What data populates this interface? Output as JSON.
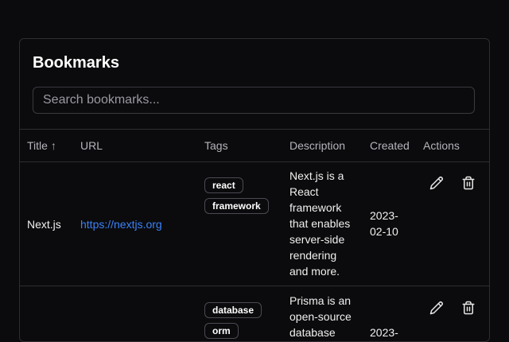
{
  "title": "Bookmarks",
  "search": {
    "placeholder": "Search bookmarks...",
    "value": ""
  },
  "columns": {
    "title": "Title ↑",
    "url": "URL",
    "tags": "Tags",
    "description": "Description",
    "created": "Created",
    "actions": "Actions"
  },
  "rows": [
    {
      "title": "Next.js",
      "url": "https://nextjs.org",
      "tags": [
        "react",
        "framework"
      ],
      "description": [
        "Next.js is a",
        "React",
        "framework",
        "that enables",
        "server-side",
        "rendering",
        "and more."
      ],
      "created": [
        "2023-",
        "02-10"
      ]
    },
    {
      "title": "",
      "url": "",
      "tags": [
        "database",
        "orm"
      ],
      "description": [
        "Prisma is an",
        "open-source",
        "database"
      ],
      "created": [
        "2023-"
      ]
    }
  ],
  "icons": {
    "edit": "pencil-icon",
    "delete": "trash-icon"
  }
}
